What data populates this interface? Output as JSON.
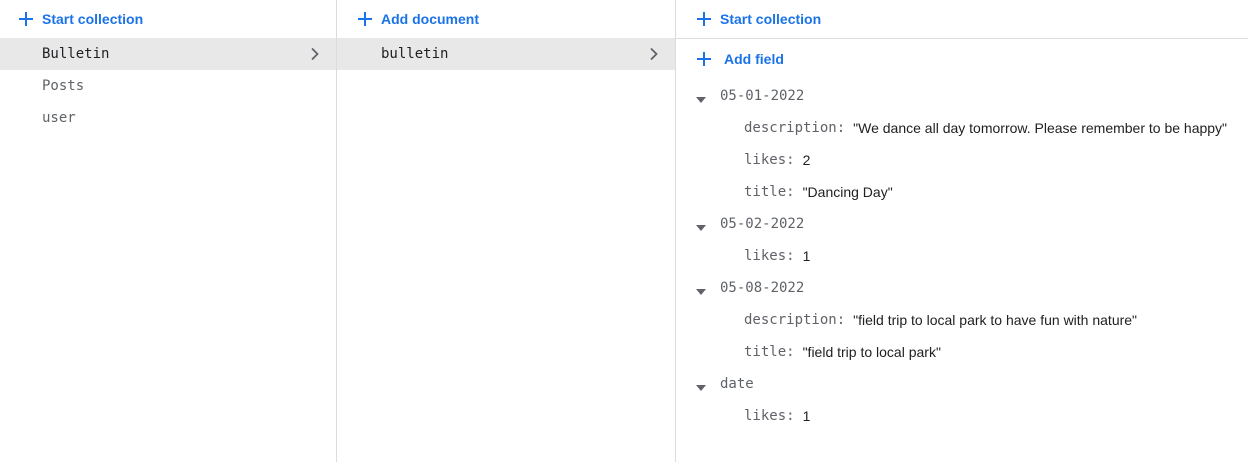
{
  "collections_panel": {
    "action_label": "Start collection",
    "items": [
      {
        "label": "Bulletin",
        "selected": true
      },
      {
        "label": "Posts",
        "selected": false
      },
      {
        "label": "user",
        "selected": false
      }
    ]
  },
  "documents_panel": {
    "action_label": "Add document",
    "items": [
      {
        "label": "bulletin",
        "selected": true
      }
    ]
  },
  "document_panel": {
    "start_collection_label": "Start collection",
    "add_field_label": "Add field",
    "maps": [
      {
        "key": "05-01-2022",
        "fields": [
          {
            "key": "description:",
            "value": "\"We dance all day tomorrow. Please remember to be happy\""
          },
          {
            "key": "likes:",
            "value": "2"
          },
          {
            "key": "title:",
            "value": "\"Dancing Day\""
          }
        ]
      },
      {
        "key": "05-02-2022",
        "fields": [
          {
            "key": "likes:",
            "value": "1"
          }
        ]
      },
      {
        "key": "05-08-2022",
        "fields": [
          {
            "key": "description:",
            "value": "\"field trip to local park to have fun with nature\""
          },
          {
            "key": "title:",
            "value": "\"field trip to local park\""
          }
        ]
      },
      {
        "key": "date",
        "fields": [
          {
            "key": "likes:",
            "value": "1"
          }
        ]
      }
    ]
  },
  "colors": {
    "accent": "#1a73e8",
    "selected_bg": "#e8e8e8",
    "divider": "#dadce0",
    "muted_text": "#5f6368"
  },
  "icons": {
    "add": "plus-icon",
    "expand": "chevron-right-icon",
    "collapse": "caret-down-icon"
  }
}
